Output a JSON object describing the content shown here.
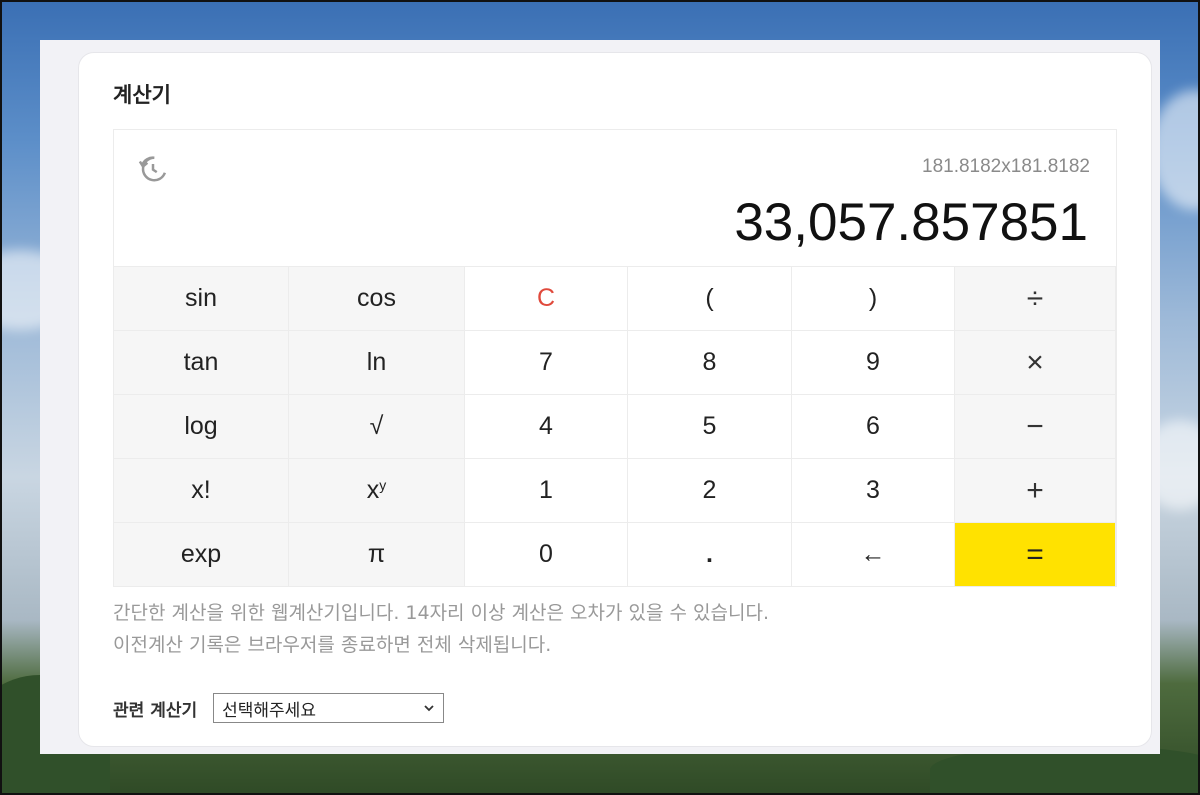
{
  "title": "계산기",
  "display": {
    "history_icon": "history-icon",
    "expression": "181.8182x181.8182",
    "result": "33,057.857851"
  },
  "keys": {
    "sin": "sin",
    "cos": "cos",
    "clear": "C",
    "lparen": "(",
    "rparen": ")",
    "divide": "÷",
    "tan": "tan",
    "ln": "ln",
    "seven": "7",
    "eight": "8",
    "nine": "9",
    "multiply": "×",
    "log": "log",
    "sqrt": "√",
    "four": "4",
    "five": "5",
    "six": "6",
    "minus": "−",
    "fact": "x!",
    "pow_base": "x",
    "pow_exp": "y",
    "one": "1",
    "two": "2",
    "three": "3",
    "plus": "+",
    "exp": "exp",
    "pi": "π",
    "zero": "0",
    "dot": ".",
    "backspace": "←",
    "equals": "="
  },
  "notes": {
    "line1": "간단한 계산을 위한 웹계산기입니다. 14자리 이상 계산은 오차가 있을 수 있습니다.",
    "line2": "이전계산 기록은 브라우저를 종료하면 전체 삭제됩니다."
  },
  "related": {
    "label": "관련 계산기",
    "selected": "선택해주세요"
  },
  "colors": {
    "equals_bg": "#ffe200",
    "clear_text": "#e04a3c"
  }
}
